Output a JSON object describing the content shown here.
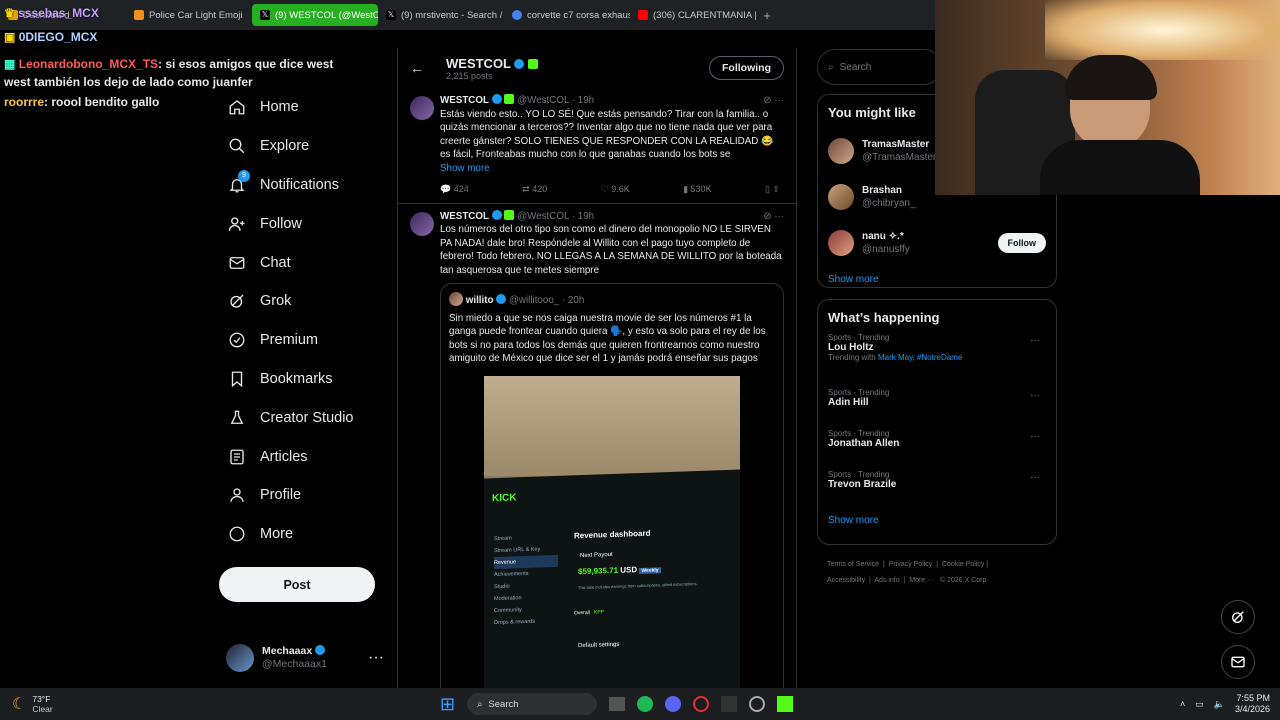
{
  "browser": {
    "tabs": [
      {
        "label": "Dashboard",
        "color": "#e6a400"
      },
      {
        "label": "Police Car Light Emoji",
        "color": "#f09020"
      },
      {
        "label": "(9) WESTCOL (@WestCOL",
        "color": "#000000"
      },
      {
        "label": "(9) mrstiventc - Search / X",
        "color": "#000000"
      },
      {
        "label": "corvette c7 corsa exhaust",
        "color": "#4285f4"
      },
      {
        "label": "(306) CLARENTMANIA | E",
        "color": "#ff0000"
      }
    ],
    "new_tab": "+"
  },
  "overlay": {
    "top_user": "sssebas_MCX",
    "second_user": "0DIEGO_MCX",
    "chat": [
      {
        "user": "Leonardobono_MCX_TS",
        "text": ": si esos amigos que dice west",
        "cont": "west también los dejo de lado como juanfer",
        "color": "#ff5a5a"
      },
      {
        "user": "roorrre",
        "text": ": roool bendito gallo",
        "cont": "",
        "color": "#ffc83c"
      }
    ]
  },
  "nav": {
    "items": [
      {
        "label": "Home",
        "icon": "home-icon"
      },
      {
        "label": "Explore",
        "icon": "search-icon"
      },
      {
        "label": "Notifications",
        "icon": "bell-icon"
      },
      {
        "label": "Follow",
        "icon": "person-add-icon"
      },
      {
        "label": "Chat",
        "icon": "mail-icon"
      },
      {
        "label": "Grok",
        "icon": "grok-icon"
      },
      {
        "label": "Premium",
        "icon": "x-premium-icon"
      },
      {
        "label": "Bookmarks",
        "icon": "bookmark-icon"
      },
      {
        "label": "Creator Studio",
        "icon": "flask-icon"
      },
      {
        "label": "Articles",
        "icon": "article-icon"
      },
      {
        "label": "Profile",
        "icon": "profile-icon"
      },
      {
        "label": "More",
        "icon": "more-circle-icon"
      }
    ],
    "notif_count": "9",
    "post": "Post",
    "account_name": "Mechaaax",
    "account_handle": "@Mechaaax1",
    "account_more": "···"
  },
  "profile_header": {
    "name": "WESTCOL",
    "posts": "2,215 posts",
    "following": "Following"
  },
  "tweets": [
    {
      "name": "WESTCOL",
      "handle": "@WestCOL",
      "time": "· 19h",
      "text": "Estás viendo esto.. YO LO SÉ! Que estás pensando? Tirar con la familia.. o quizás mencionar a terceros?? Inventar algo que no tiene nada que ver para creerte gánster? SOLO TIENES QUE RESPONDER CON LA REALIDAD 😂 es fácil, Fronteabas mucho con lo que ganabas cuando los bots se",
      "show_more": "Show more",
      "replies": "424",
      "reposts": "420",
      "likes": "9.6K",
      "views": "530K"
    },
    {
      "name": "WESTCOL",
      "handle": "@WestCOL",
      "time": "· 19h",
      "text": "Los números del otro tipo son como el dinero del monopolio NO LE SIRVEN PA NADA! dale bro! Respóndele al Willito con el pago tuyo completo de febrero! Todo febrero, NO LLEGAS A LA SEMANA DE WILLITO por la boteada tan asquerosa que te metes siempre"
    }
  ],
  "quote": {
    "name": "willito",
    "handle": "@willitooo_",
    "time": "· 20h",
    "text": "Sin miedo a que se nos caiga nuestra movie de ser los números #1 la ganga puede frontear cuando quiera 🗣️, y esto va solo para el rey de los bots si no para todos los demás que quieren frontrearnos como nuestro amiguito de México que dice ser el 1 y jamás podrá enseñar sus pagos"
  },
  "screenshot": {
    "brand": "KICK",
    "title": "Revenue dashboard",
    "menu": [
      "Stream",
      "Stream URL & Key",
      "Revenue",
      "Achievements",
      "Studio",
      "Moderation",
      "Community",
      "Drops & rewards"
    ],
    "next_payout": "Next Payout",
    "amount": "$59,935.71",
    "currency": "USD",
    "period": "Weekly",
    "note": "This total includes earnings from subscriptions, gifted subscriptions,",
    "tab_overall": "Overall",
    "tab_kpp": "KPP",
    "default_settings": "Default settings"
  },
  "right": {
    "search_placeholder": "Search",
    "might_like": "You might like",
    "suggestions": [
      {
        "name": "TramasMaster",
        "handle": "@TramasMaster"
      },
      {
        "name": "Brashan",
        "handle": "@chibryan_"
      },
      {
        "name": "nanu ✧.*",
        "handle": "@nanusffy"
      }
    ],
    "follow": "Follow",
    "show_more": "Show more",
    "happening": "What’s happening",
    "trends": [
      {
        "cat": "Sports · Trending",
        "name": "Lou Holtz",
        "with_label": "Trending with",
        "with": "Mark May, #NotreDame"
      },
      {
        "cat": "Sports · Trending",
        "name": "Adin Hill"
      },
      {
        "cat": "Sports · Trending",
        "name": "Jonathan Allen"
      },
      {
        "cat": "Sports · Trending",
        "name": "Trevon Brazile"
      }
    ],
    "show_more2": "Show more",
    "footer1": [
      "Terms of Service",
      "Privacy Policy",
      "Cookie Policy"
    ],
    "footer2": [
      "Accessibility",
      "Ads info",
      "More ···",
      "© 2026 X Corp."
    ]
  },
  "taskbar": {
    "temp": "73°F",
    "weather": "Clear",
    "search": "Search",
    "time": "7:55 PM",
    "date": "3/4/2026"
  }
}
